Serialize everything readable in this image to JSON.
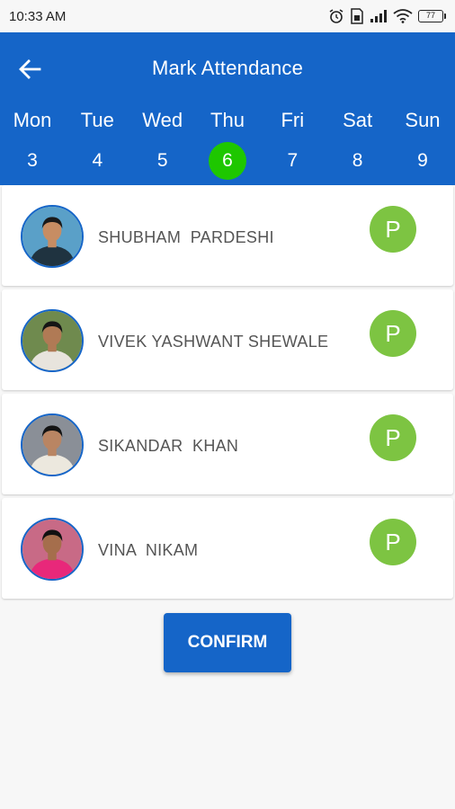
{
  "status_bar": {
    "time": "10:33 AM",
    "battery": "77"
  },
  "header": {
    "title": "Mark Attendance",
    "back_icon": "arrow-left-icon"
  },
  "week": [
    {
      "name": "Mon",
      "date": "3",
      "selected": false
    },
    {
      "name": "Tue",
      "date": "4",
      "selected": false
    },
    {
      "name": "Wed",
      "date": "5",
      "selected": false
    },
    {
      "name": "Thu",
      "date": "6",
      "selected": true
    },
    {
      "name": "Fri",
      "date": "7",
      "selected": false
    },
    {
      "name": "Sat",
      "date": "8",
      "selected": false
    },
    {
      "name": "Sun",
      "date": "9",
      "selected": false
    }
  ],
  "students": [
    {
      "name": "SHUBHAM  PARDESHI",
      "status": "P"
    },
    {
      "name": "VIVEK YASHWANT SHEWALE",
      "status": "P"
    },
    {
      "name": "SIKANDAR  KHAN",
      "status": "P"
    },
    {
      "name": "VINA  NIKAM",
      "status": "P"
    }
  ],
  "confirm_label": "CONFIRM",
  "colors": {
    "primary": "#1565c8",
    "selected_day": "#1ec700",
    "present_badge": "#7dc442"
  }
}
